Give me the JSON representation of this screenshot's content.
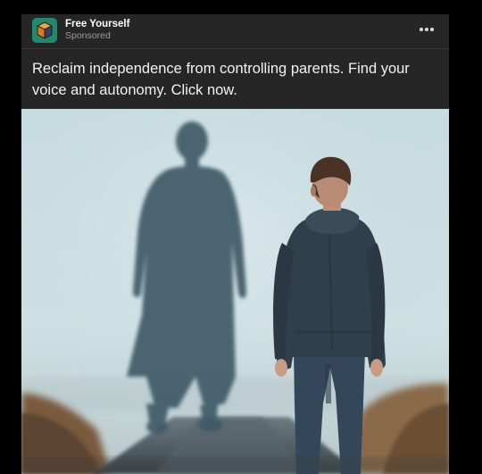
{
  "ad": {
    "brand": {
      "name": "Free Yourself",
      "label": "Sponsored",
      "icon": "cube-logo-icon"
    },
    "menu_icon": "more-horizontal-icon",
    "caption": "Reclaim independence from controlling parents. Find your voice and autonomy. Click now.",
    "image": {
      "description_icon": "ad-photo",
      "colors": {
        "sky": "#c9dde2",
        "shadow": "#3d5764",
        "hoodie": "#2e3d48"
      }
    }
  },
  "colors": {
    "page_background": "#000000",
    "card_background": "#262626",
    "text_primary": "#ffffff",
    "text_secondary": "#9b9b9b",
    "logo_background": "#1f8a6e"
  }
}
